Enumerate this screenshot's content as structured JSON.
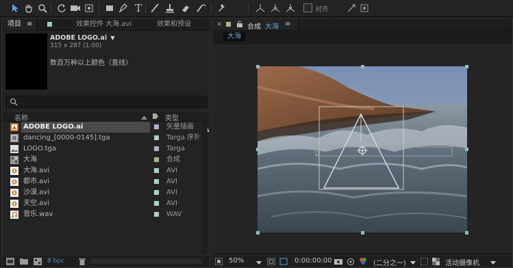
{
  "toolbar": {
    "snap_label": "对齐",
    "tools": [
      "selection-tool",
      "hand-tool",
      "zoom-tool",
      "rotation-tool",
      "camera-tool",
      "pan-behind-tool",
      "rectangle-tool",
      "pen-tool",
      "type-tool",
      "brush-tool",
      "clone-stamp-tool",
      "eraser-tool",
      "roto-brush-tool",
      "puppet-pin-tool"
    ]
  },
  "project_panel": {
    "tabs": [
      "项目",
      "效果控件 大海.avi",
      "效果和预设"
    ],
    "tab_menu": "≡",
    "selected_item": {
      "name": "ADOBE LOGO.ai",
      "dropdown": "▼",
      "size": "315 x 287 (1.00)",
      "color": "数百万种以上颜色（直线）"
    },
    "search_placeholder": "",
    "columns": {
      "name": "名称",
      "type": "类型"
    },
    "items": [
      {
        "name": "ADOBE LOGO.ai",
        "type": "矢量插画",
        "icon": "vector-file-icon",
        "label_color": "#b8aed3",
        "selected": true
      },
      {
        "name": "dancing_[0000-0145].tga",
        "type": "Targa 序列",
        "icon": "image-sequence-icon",
        "label_color": "#a6d4c6"
      },
      {
        "name": "LOGO.tga",
        "type": "Targa",
        "icon": "image-file-icon",
        "label_color": "#b8aed3"
      },
      {
        "name": "大海",
        "type": "合成",
        "icon": "composition-icon",
        "label_color": "#b7ad8c"
      },
      {
        "name": "大海.avi",
        "type": "AVI",
        "icon": "video-file-icon",
        "label_color": "#a6d4c6"
      },
      {
        "name": "都市.avi",
        "type": "AVI",
        "icon": "video-file-icon",
        "label_color": "#a6d4c6"
      },
      {
        "name": "沙漠.avi",
        "type": "AVI",
        "icon": "video-file-icon",
        "label_color": "#a6d4c6"
      },
      {
        "name": "天空.avi",
        "type": "AVI",
        "icon": "video-file-icon",
        "label_color": "#a6d4c6"
      },
      {
        "name": "音乐.wav",
        "type": "WAV",
        "icon": "audio-file-icon",
        "label_color": "#a6d4c6"
      }
    ],
    "bit_depth": "8 bpc"
  },
  "composition_panel": {
    "close": "×",
    "tab_label": "合成",
    "tab_comp_name": "大海",
    "tab_menu": "≡",
    "comp_name_tab": "大海",
    "zoom": "50%",
    "timecode": "0:00:00:00",
    "resolution": "(二分之一)",
    "camera": "活动摄像机"
  }
}
